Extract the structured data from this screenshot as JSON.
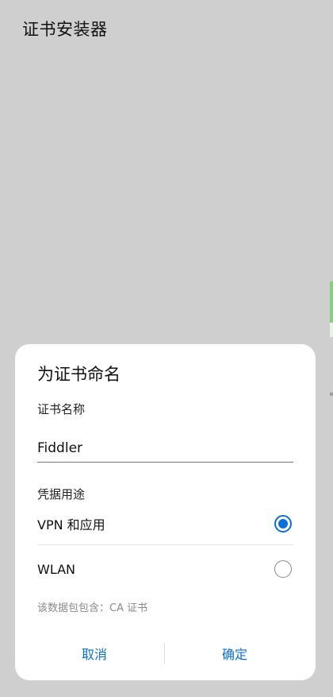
{
  "app": {
    "title": "证书安装器"
  },
  "dialog": {
    "title": "为证书命名",
    "name_label": "证书名称",
    "name_value": "Fiddler",
    "usage_label": "凭据用途",
    "options": [
      {
        "label": "VPN 和应用",
        "selected": true
      },
      {
        "label": "WLAN",
        "selected": false
      }
    ],
    "contents_note": "该数据包包含：CA 证书",
    "cancel_label": "取消",
    "confirm_label": "确定"
  },
  "colors": {
    "accent": "#0a6fd8",
    "backdrop": "#cfcfcf"
  }
}
